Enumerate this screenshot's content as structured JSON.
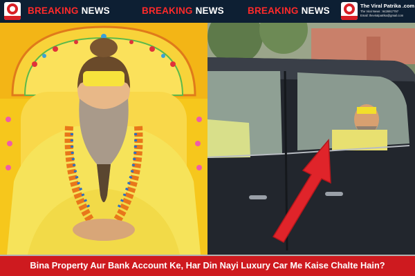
{
  "banner": {
    "breaking": [
      {
        "word1": "BREAKING",
        "word2": "NEWS"
      },
      {
        "word1": "BREAKING",
        "word2": "NEWS"
      },
      {
        "word1": "BREAKING",
        "word2": "NEWS"
      }
    ],
    "brand_name": "The Viral Patrika .com",
    "brand_line1": "The Viral News : 9426917797",
    "brand_line2": "Email: theviralpatrika@gmail.com"
  },
  "caption": {
    "text": "Bina Property Aur Bank Account Ke, Har Din Nayi Luxury Car Me Kaise Chalte Hain?"
  },
  "colors": {
    "banner_bg": "#0d1f33",
    "breaking_red": "#ff2a2a",
    "caption_bg": "#ce1a1f",
    "arrow": "#e0242a"
  }
}
